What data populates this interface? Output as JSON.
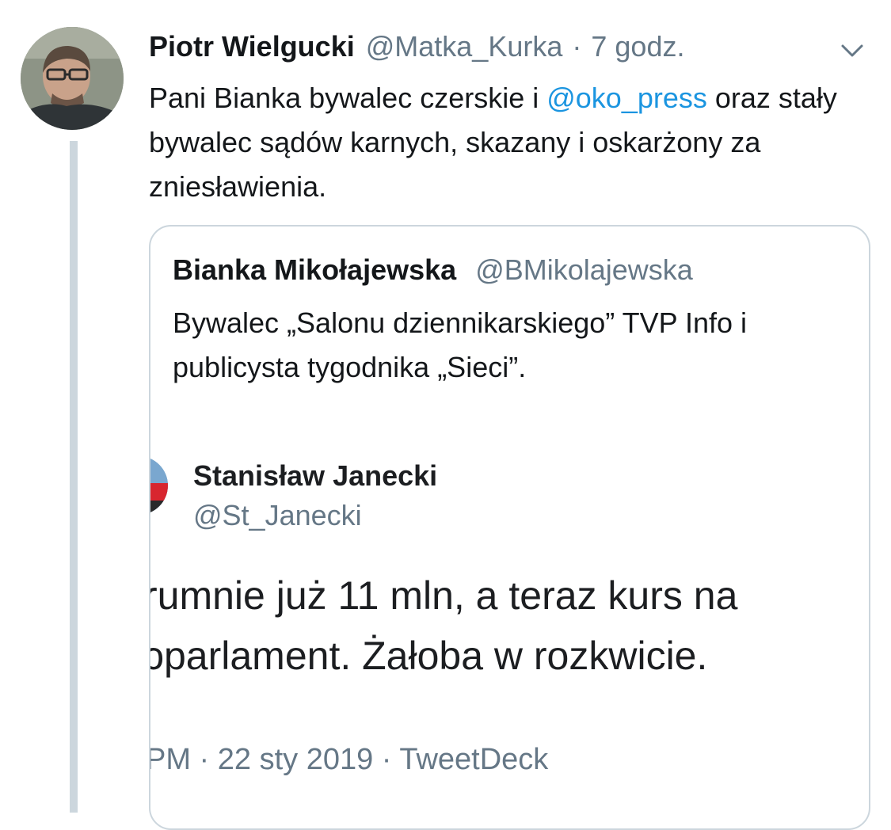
{
  "tweet": {
    "author": {
      "display_name": "Piotr Wielgucki",
      "handle": "@Matka_Kurka",
      "separator": "·",
      "time": "7 godz."
    },
    "text_parts": {
      "part1": "Pani Bianka bywalec czerskie i ",
      "mention": "@oko_press",
      "part2": " oraz stały bywalec sądów karnych, skazany i oskarżony za zniesławienia."
    },
    "menu_icon": "chevron-down-icon",
    "quoted": {
      "display_name": "Bianka Mikołajewska",
      "handle": "@BMikolajewska",
      "text": "Bywalec „Salonu dziennikarskiego” TVP Info i publicysta tygodnika „Sieci”.",
      "embedded_screenshot": {
        "display_name": "Stanisław Janecki",
        "handle": "@St_Janecki",
        "body_lines": [
          "ɾumnie już 11 mln, a teraz kurs na",
          "ɔparlament. Żałoba w rozkwicie."
        ],
        "meta": "PM · 22 sty 2019 · TweetDeck"
      }
    }
  },
  "colors": {
    "text": "#14171a",
    "secondary": "#657786",
    "link": "#1b95e0",
    "border": "#ccd6dd"
  }
}
